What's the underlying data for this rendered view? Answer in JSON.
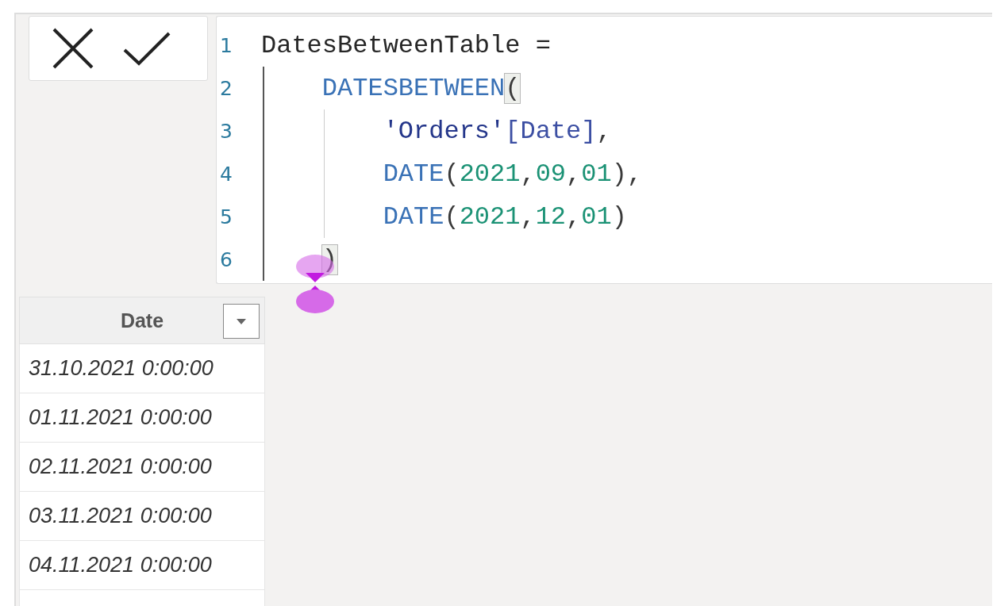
{
  "formula_bar": {
    "code_lines": [
      {
        "number": "1",
        "tokens": [
          {
            "text": "DatesBetweenTable =",
            "kind": "plain",
            "highlighted": false
          }
        ],
        "children": [
          {
            "number": "2",
            "tokens": [
              {
                "text": "DATESBETWEEN",
                "kind": "function",
                "highlighted": false
              },
              {
                "text": "(",
                "kind": "punct",
                "highlighted": true
              }
            ],
            "children": [
              {
                "number": "3",
                "tokens": [
                  {
                    "text": "'Orders'",
                    "kind": "table",
                    "highlighted": false
                  },
                  {
                    "text": "[Date]",
                    "kind": "column",
                    "highlighted": false
                  },
                  {
                    "text": ",",
                    "kind": "punct",
                    "highlighted": false
                  }
                ]
              },
              {
                "number": "4",
                "tokens": [
                  {
                    "text": "DATE",
                    "kind": "function",
                    "highlighted": false
                  },
                  {
                    "text": "(",
                    "kind": "punct",
                    "highlighted": false
                  },
                  {
                    "text": "2021",
                    "kind": "number",
                    "highlighted": false
                  },
                  {
                    "text": ",",
                    "kind": "punct",
                    "highlighted": false
                  },
                  {
                    "text": "09",
                    "kind": "number",
                    "highlighted": false
                  },
                  {
                    "text": ",",
                    "kind": "punct",
                    "highlighted": false
                  },
                  {
                    "text": "01",
                    "kind": "number",
                    "highlighted": false
                  },
                  {
                    "text": "),",
                    "kind": "punct",
                    "highlighted": false
                  }
                ]
              },
              {
                "number": "5",
                "tokens": [
                  {
                    "text": "DATE",
                    "kind": "function",
                    "highlighted": false
                  },
                  {
                    "text": "(",
                    "kind": "punct",
                    "highlighted": false
                  },
                  {
                    "text": "2021",
                    "kind": "number",
                    "highlighted": false
                  },
                  {
                    "text": ",",
                    "kind": "punct",
                    "highlighted": false
                  },
                  {
                    "text": "12",
                    "kind": "number",
                    "highlighted": false
                  },
                  {
                    "text": ",",
                    "kind": "punct",
                    "highlighted": false
                  },
                  {
                    "text": "01",
                    "kind": "number",
                    "highlighted": false
                  },
                  {
                    "text": ")",
                    "kind": "punct",
                    "highlighted": false
                  }
                ]
              }
            ]
          },
          {
            "number": "6",
            "tokens": [
              {
                "text": ")",
                "kind": "punct",
                "highlighted": true
              }
            ]
          }
        ]
      }
    ]
  },
  "table": {
    "columns": [
      {
        "label": "Date"
      }
    ],
    "rows": [
      [
        "31.10.2021 0:00:00"
      ],
      [
        "01.11.2021 0:00:00"
      ],
      [
        "02.11.2021 0:00:00"
      ],
      [
        "03.11.2021 0:00:00"
      ],
      [
        "04.11.2021 0:00:00"
      ]
    ]
  }
}
